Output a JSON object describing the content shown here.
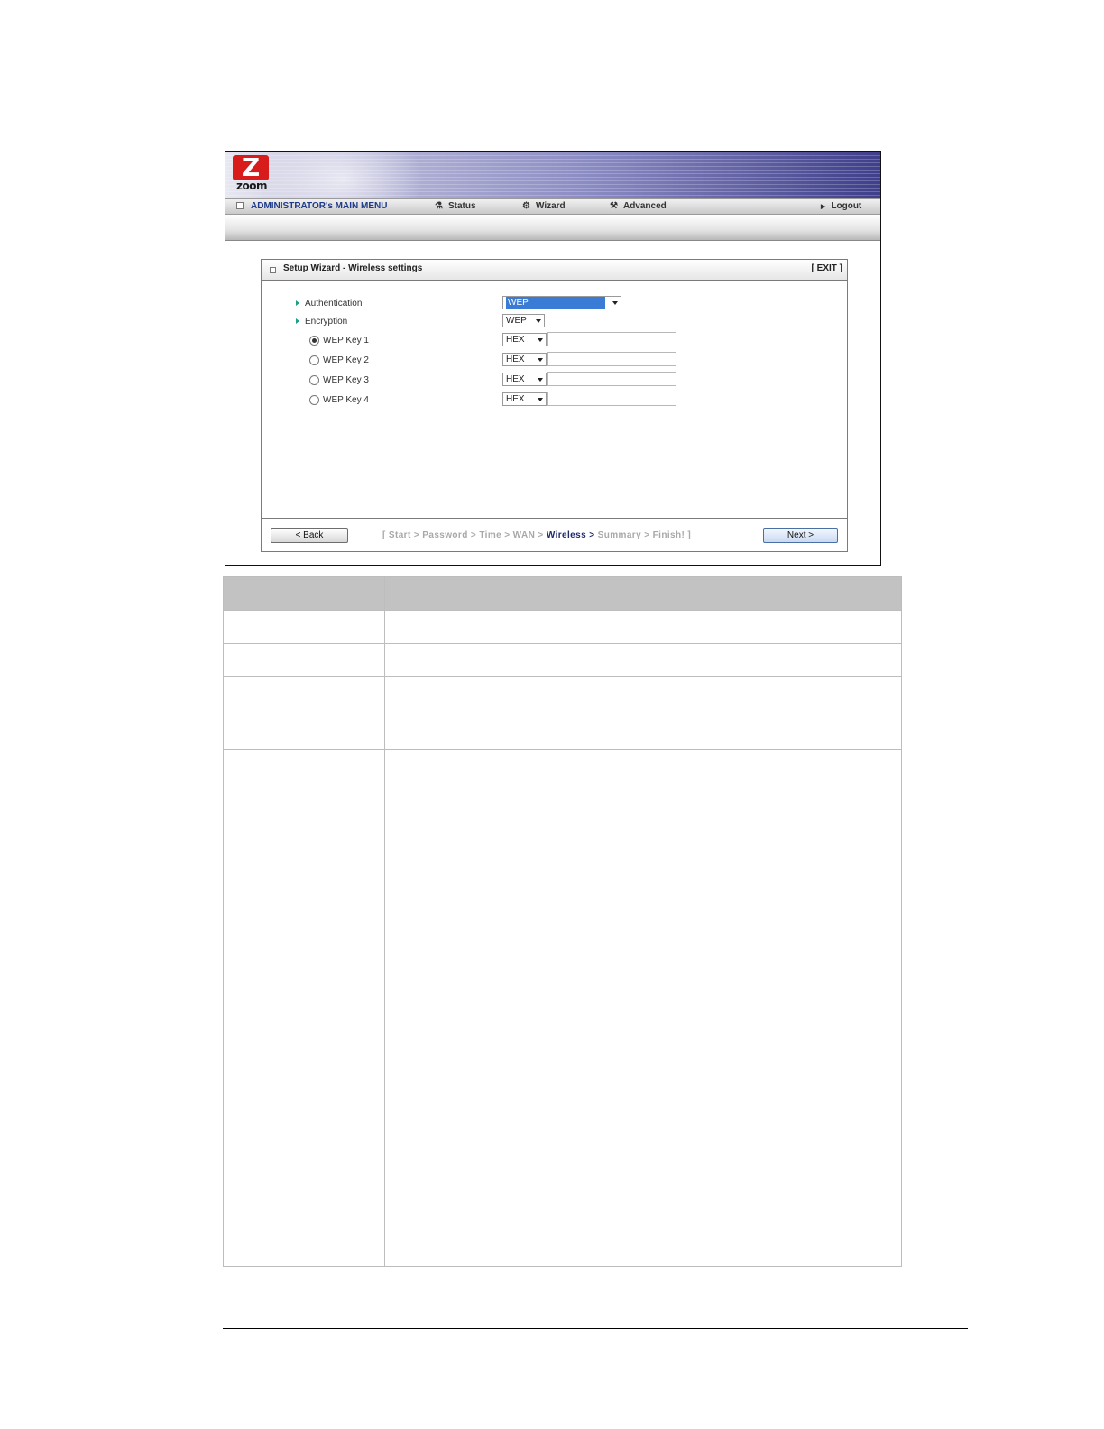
{
  "menu": {
    "admin_label": "ADMINISTRATOR's MAIN MENU",
    "status_label": "Status",
    "wizard_label": "Wizard",
    "advanced_label": "Advanced",
    "logout_label": "Logout"
  },
  "logo": {
    "letter": "Z",
    "word": "zoom"
  },
  "panel": {
    "title": "Setup Wizard - Wireless settings",
    "exit_label": "[ EXIT ]"
  },
  "form": {
    "authentication_label": "Authentication",
    "authentication_value": "WEP",
    "encryption_label": "Encryption",
    "encryption_value": "WEP",
    "keys": [
      {
        "label": "WEP Key 1",
        "format": "HEX",
        "value": "",
        "selected": true
      },
      {
        "label": "WEP Key 2",
        "format": "HEX",
        "value": "",
        "selected": false
      },
      {
        "label": "WEP Key 3",
        "format": "HEX",
        "value": "",
        "selected": false
      },
      {
        "label": "WEP Key 4",
        "format": "HEX",
        "value": "",
        "selected": false
      }
    ]
  },
  "footer": {
    "back_label": "< Back",
    "next_label": "Next >",
    "crumb_open": "[ Start > Password > Time > WAN > ",
    "crumb_active": "Wireless",
    "crumb_gt": " > ",
    "crumb_close": "Summary > Finish! ]"
  },
  "colors": {
    "accent_blue": "#1e3a8a",
    "logo_red": "#d81b1b",
    "triangle": "#1aa08a",
    "header_gray": "#c2c2c2"
  }
}
